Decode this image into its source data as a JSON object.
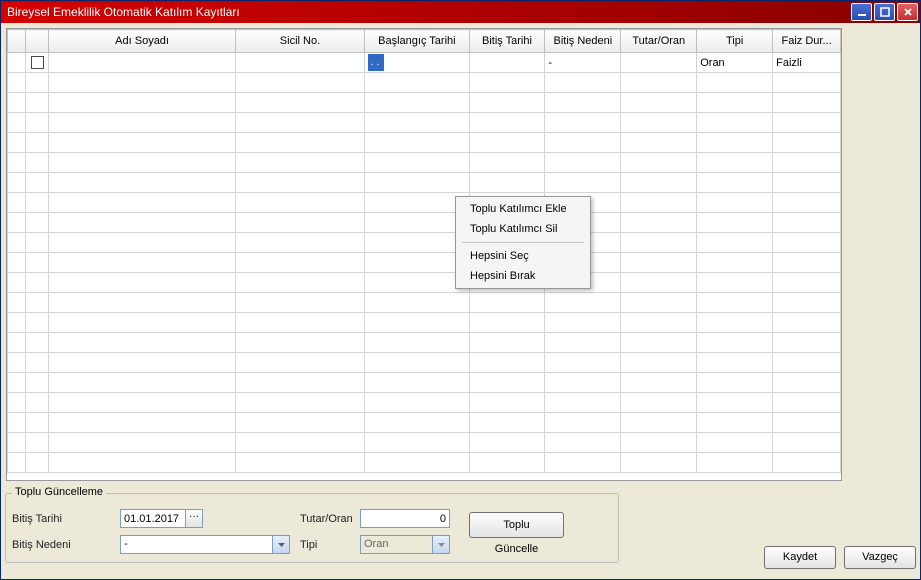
{
  "window": {
    "title": "Bireysel Emeklilik Otomatik Katılım Kayıtları"
  },
  "grid": {
    "columns": {
      "name": "Adı Soyadı",
      "sicil": "Sicil No.",
      "start": "Başlangıç Tarihi",
      "end": "Bitiş Tarihi",
      "reason": "Bitiş Nedeni",
      "amount": "Tutar/Oran",
      "type": "Tipi",
      "faiz": "Faiz Dur..."
    },
    "row1": {
      "start": ". .",
      "reason": "-",
      "type": "Oran",
      "faiz": "Faizli"
    }
  },
  "contextMenu": {
    "addBulk": "Toplu Katılımcı Ekle",
    "removeBulk": "Toplu Katılımcı Sil",
    "selectAll": "Hepsini Seç",
    "deselectAll": "Hepsini Bırak"
  },
  "bulkUpdate": {
    "legend": "Toplu Güncelleme",
    "endDateLabel": "Bitiş Tarihi",
    "endDateValue": "01.01.2017",
    "reasonLabel": "Bitiş Nedeni",
    "reasonValue": "-",
    "amountLabel": "Tutar/Oran",
    "amountValue": "0",
    "typeLabel": "Tipi",
    "typeValue": "Oran",
    "bulkBtn": "Toplu Güncelle"
  },
  "footer": {
    "save": "Kaydet",
    "cancel": "Vazgeç"
  }
}
